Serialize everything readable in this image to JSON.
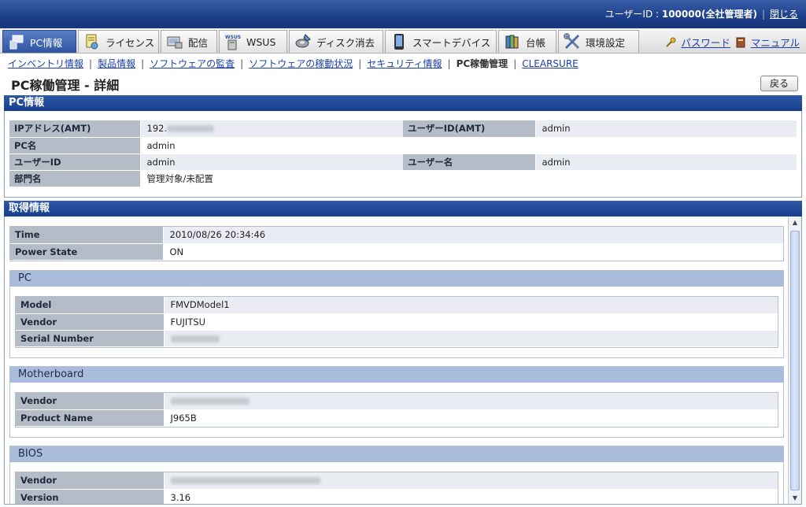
{
  "header": {
    "user_label": "ユーザーID : ",
    "user_value": "100000(全社管理者)",
    "close_link": "閉じる"
  },
  "tabs": [
    {
      "label": "PC情報",
      "icon": "pc-info-icon",
      "active": true
    },
    {
      "label": "ライセンス",
      "icon": "license-icon"
    },
    {
      "label": "配信",
      "icon": "distribution-icon"
    },
    {
      "label": "WSUS",
      "icon": "wsus-icon"
    },
    {
      "label": "ディスク消去",
      "icon": "disk-erase-icon"
    },
    {
      "label": "スマートデバイス",
      "icon": "smart-device-icon"
    },
    {
      "label": "台帳",
      "icon": "ledger-icon"
    },
    {
      "label": "環境設定",
      "icon": "settings-tools-icon"
    }
  ],
  "right_links": {
    "password": "パスワード",
    "manual": "マニュアル"
  },
  "subnav": [
    {
      "label": "インベントリ情報",
      "link": true
    },
    {
      "label": "製品情報",
      "link": true
    },
    {
      "label": "ソフトウェアの監査",
      "link": true
    },
    {
      "label": "ソフトウェアの稼動状況",
      "link": true
    },
    {
      "label": "セキュリティ情報",
      "link": true
    },
    {
      "label": "PC稼働管理",
      "link": false
    },
    {
      "label": "CLEARSURE",
      "link": true
    }
  ],
  "page_title": "PC稼働管理 - 詳細",
  "back_button": "戻る",
  "pc_info": {
    "heading": "PC情報",
    "ip_label": "IPアドレス(AMT)",
    "ip_value": "192.",
    "amt_user_label": "ユーザーID(AMT)",
    "amt_user_value": "admin",
    "pc_name_label": "PC名",
    "pc_name_value": "admin",
    "user_id_label": "ユーザーID",
    "user_id_value": "admin",
    "user_name_label": "ユーザー名",
    "user_name_value": "admin",
    "dept_label": "部門名",
    "dept_value": "管理対象/未配置"
  },
  "acquired": {
    "heading": "取得情報",
    "time_label": "Time",
    "time_value": "2010/08/26 20:34:46",
    "power_label": "Power State",
    "power_value": "ON",
    "pc": {
      "heading": "PC",
      "model_label": "Model",
      "model_value": "FMVDModel1",
      "vendor_label": "Vendor",
      "vendor_value": "FUJITSU",
      "serial_label": "Serial Number"
    },
    "motherboard": {
      "heading": "Motherboard",
      "vendor_label": "Vendor",
      "product_label": "Product Name",
      "product_value": "J965B"
    },
    "bios": {
      "heading": "BIOS",
      "vendor_label": "Vendor",
      "version_label": "Version",
      "version_value": "3.16"
    }
  }
}
